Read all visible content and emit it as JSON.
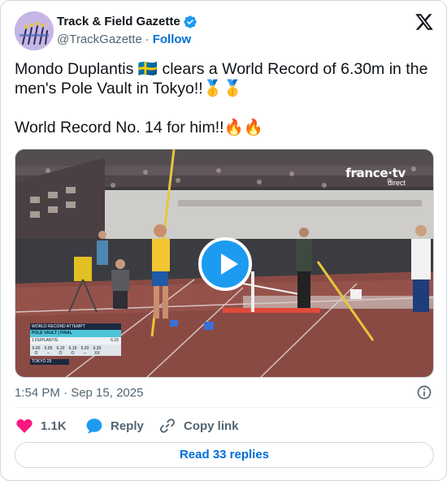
{
  "author": {
    "name": "Track & Field Gazette",
    "handle": "@TrackGazette",
    "separator": "·",
    "follow_label": "Follow"
  },
  "icons": {
    "verified": "verified-badge-icon",
    "logo": "x-logo-icon",
    "info": "info-icon",
    "like": "heart-icon",
    "reply": "speech-bubble-icon",
    "copy": "link-icon",
    "play": "play-icon"
  },
  "tweet": {
    "line1": "Mondo Duplantis 🇸🇪 clears a World Record of 6.30m in the men's Pole Vault in Tokyo!!🥇🥇",
    "line2": "World Record No. 14 for him!!🔥🔥"
  },
  "media": {
    "broadcaster": "france·tv",
    "broadcaster_sub": "direct",
    "scoreboard": {
      "title": "WORLD RECORD ATTEMPT",
      "event": "POLE VAULT | FINAL",
      "rank": "1",
      "athlete": "DUPLANTIS",
      "best": "6.15",
      "heights": [
        "6.00",
        "6.05",
        "6.10",
        "6.15",
        "6.20",
        "6.30"
      ],
      "results": [
        "O",
        "–",
        "O",
        "O",
        "–",
        "XX"
      ],
      "footer": "TOKYO 25"
    }
  },
  "timestamp": "1:54 PM · Sep 15, 2025",
  "actions": {
    "like_count": "1.1K",
    "reply_label": "Reply",
    "copy_label": "Copy link"
  },
  "replies_button": "Read 33 replies",
  "colors": {
    "accent": "#1d9bf0",
    "link": "#006fd6",
    "like": "#f91880",
    "secondary_text": "#536471"
  }
}
